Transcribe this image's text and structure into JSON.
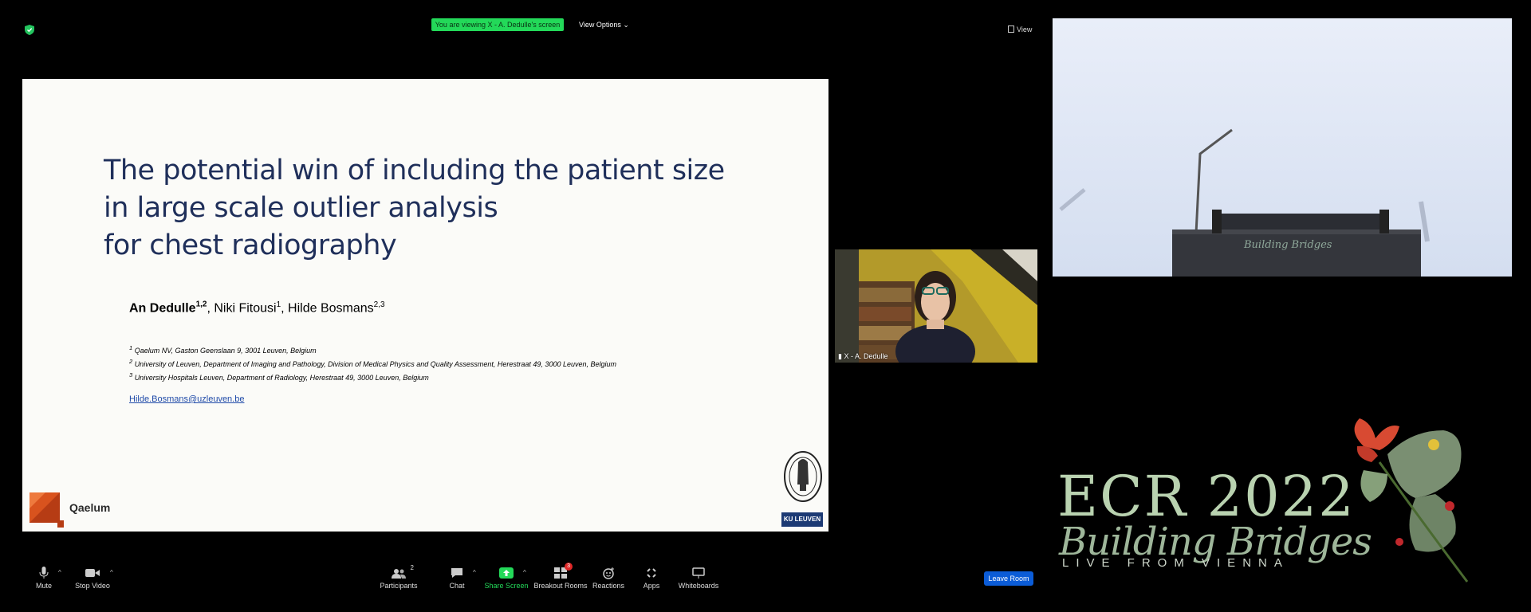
{
  "top_bar": {
    "viewing_banner": "You are viewing X - A. Dedulle's screen",
    "view_options": "View Options",
    "view_button": "View"
  },
  "slide": {
    "title": "The potential win of including the patient size\nin large scale outlier analysis\nfor chest radiography",
    "authors": [
      {
        "name": "An Dedulle",
        "sup": "1,2",
        "bold": true
      },
      {
        "name": "Niki Fitousi",
        "sup": "1",
        "bold": false
      },
      {
        "name": "Hilde Bosmans",
        "sup": "2,3",
        "bold": false
      }
    ],
    "affiliations": [
      {
        "num": "1",
        "text": "Qaelum NV, Gaston Geenslaan 9, 3001 Leuven, Belgium"
      },
      {
        "num": "2",
        "text": "University of Leuven, Department of Imaging and Pathology, Division of Medical Physics and Quality Assessment, Herestraat 49, 3000 Leuven, Belgium"
      },
      {
        "num": "3",
        "text": "University Hospitals Leuven, Department of Radiology, Herestraat 49, 3000 Leuven, Belgium"
      }
    ],
    "email": "Hilde.Bosmans@uzleuven.be",
    "company_logo_text": "Qaelum",
    "university_logo_text": "KU LEUVEN"
  },
  "speaker": {
    "label": "X - A. Dedulle"
  },
  "podium": {
    "sign_text": "Building Bridges"
  },
  "branding": {
    "title": "ECR 2022",
    "subtitle": "Building Bridges",
    "tagline": "LIVE FROM VIENNA"
  },
  "toolbar": {
    "mute": "Mute",
    "stop_video": "Stop Video",
    "participants": "Participants",
    "participants_count": "2",
    "chat": "Chat",
    "share_screen": "Share Screen",
    "breakout_rooms": "Breakout Rooms",
    "breakout_badge": "3",
    "reactions": "Reactions",
    "apps": "Apps",
    "whiteboards": "Whiteboards",
    "leave_room": "Leave Room"
  },
  "colors": {
    "banner_green": "#23d959",
    "share_green": "#23d959",
    "leave_blue": "#0b5cd7",
    "slide_title_navy": "#1f2f5a"
  }
}
